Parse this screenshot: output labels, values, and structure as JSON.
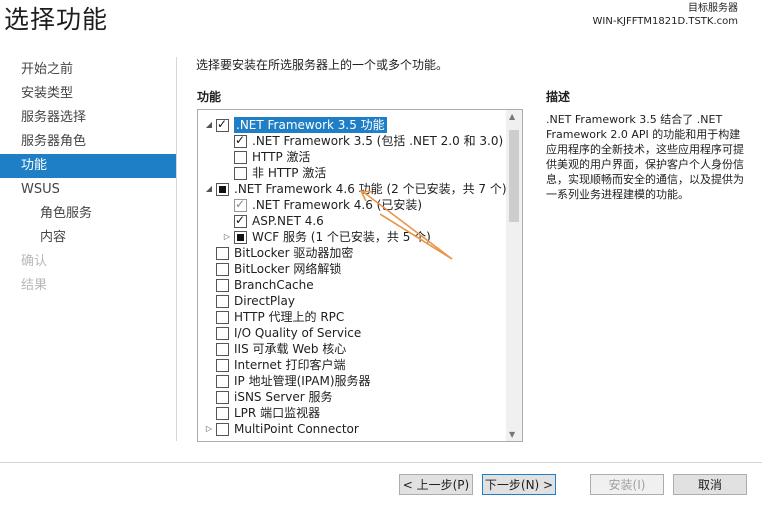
{
  "page": {
    "title": "选择功能"
  },
  "destination": {
    "label": "目标服务器",
    "server": "WIN-KJFFTM1821D.TSTK.com"
  },
  "nav": {
    "items": [
      {
        "label": "开始之前",
        "state": "normal"
      },
      {
        "label": "安装类型",
        "state": "normal"
      },
      {
        "label": "服务器选择",
        "state": "normal"
      },
      {
        "label": "服务器角色",
        "state": "normal"
      },
      {
        "label": "功能",
        "state": "active"
      },
      {
        "label": "WSUS",
        "state": "normal"
      },
      {
        "label": "角色服务",
        "state": "sub"
      },
      {
        "label": "内容",
        "state": "sub"
      },
      {
        "label": "确认",
        "state": "disabled"
      },
      {
        "label": "结果",
        "state": "disabled"
      }
    ]
  },
  "main": {
    "instruction": "选择要安装在所选服务器上的一个或多个功能。",
    "features_label": "功能",
    "description_label": "描述",
    "description_text": ".NET Framework 3.5 结合了 .NET Framework 2.0 API 的功能和用于构建应用程序的全新技术，这些应用程序可提供美观的用户界面，保护客户个人身份信息，实现顺畅而安全的通信，以及提供为一系列业务进程建模的功能。"
  },
  "features": [
    {
      "label": ".NET Framework 3.5 功能",
      "level": 0,
      "expander": "expanded",
      "check": "checked",
      "selected": true
    },
    {
      "label": ".NET Framework 3.5 (包括 .NET 2.0 和 3.0)",
      "level": 1,
      "expander": "none",
      "check": "checked",
      "selected": false
    },
    {
      "label": "HTTP 激活",
      "level": 1,
      "expander": "none",
      "check": "unchecked",
      "selected": false
    },
    {
      "label": "非 HTTP 激活",
      "level": 1,
      "expander": "none",
      "check": "unchecked",
      "selected": false
    },
    {
      "label": ".NET Framework 4.6 功能 (2 个已安装，共 7 个)",
      "level": 0,
      "expander": "expanded",
      "check": "partial",
      "selected": false
    },
    {
      "label": ".NET Framework 4.6 (已安装)",
      "level": 1,
      "expander": "none",
      "check": "checked-gray",
      "selected": false
    },
    {
      "label": "ASP.NET 4.6",
      "level": 1,
      "expander": "none",
      "check": "checked",
      "selected": false
    },
    {
      "label": "WCF 服务 (1 个已安装，共 5 个)",
      "level": 1,
      "expander": "collapsed",
      "check": "partial",
      "selected": false
    },
    {
      "label": "BitLocker 驱动器加密",
      "level": 0,
      "expander": "none",
      "check": "unchecked",
      "selected": false
    },
    {
      "label": "BitLocker 网络解锁",
      "level": 0,
      "expander": "none",
      "check": "unchecked",
      "selected": false
    },
    {
      "label": "BranchCache",
      "level": 0,
      "expander": "none",
      "check": "unchecked",
      "selected": false
    },
    {
      "label": "DirectPlay",
      "level": 0,
      "expander": "none",
      "check": "unchecked",
      "selected": false
    },
    {
      "label": "HTTP 代理上的 RPC",
      "level": 0,
      "expander": "none",
      "check": "unchecked",
      "selected": false
    },
    {
      "label": "I/O Quality of Service",
      "level": 0,
      "expander": "none",
      "check": "unchecked",
      "selected": false
    },
    {
      "label": "IIS 可承载 Web 核心",
      "level": 0,
      "expander": "none",
      "check": "unchecked",
      "selected": false
    },
    {
      "label": "Internet 打印客户端",
      "level": 0,
      "expander": "none",
      "check": "unchecked",
      "selected": false
    },
    {
      "label": "IP 地址管理(IPAM)服务器",
      "level": 0,
      "expander": "none",
      "check": "unchecked",
      "selected": false
    },
    {
      "label": "iSNS Server 服务",
      "level": 0,
      "expander": "none",
      "check": "unchecked",
      "selected": false
    },
    {
      "label": "LPR 端口监视器",
      "level": 0,
      "expander": "none",
      "check": "unchecked",
      "selected": false
    },
    {
      "label": "MultiPoint Connector",
      "level": 0,
      "expander": "collapsed",
      "check": "unchecked",
      "selected": false
    }
  ],
  "buttons": {
    "prev": "< 上一步(P)",
    "next": "下一步(N) >",
    "install": "安装(I)",
    "cancel": "取消"
  },
  "colors": {
    "accent": "#1e7fc6",
    "annotation_arrow": "#e8964a"
  }
}
